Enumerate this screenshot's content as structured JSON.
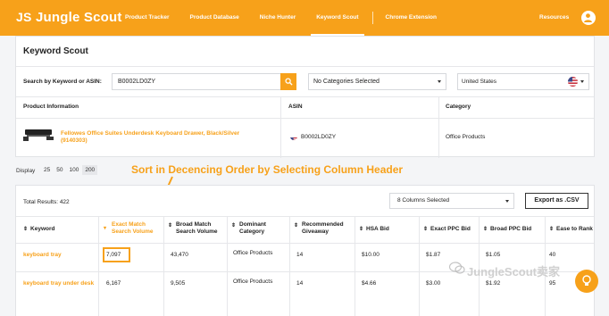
{
  "brand": {
    "name": "Jungle Scout",
    "accent": "#f7a11a"
  },
  "nav": {
    "items": [
      "Product Tracker",
      "Product Database",
      "Niche Hunter",
      "Keyword Scout",
      "Chrome Extension"
    ],
    "active": "Keyword Scout",
    "resources": "Resources"
  },
  "search_panel": {
    "title": "Keyword Scout",
    "search_label": "Search by Keyword or ASIN:",
    "search_value": "B0002LD0ZY",
    "category_select": "No Categories Selected",
    "country_select": "United States",
    "columns": [
      "Product Information",
      "ASIN",
      "Category"
    ],
    "product": {
      "name": "Fellowes Office Suites Underdesk Keyboard Drawer, Black/Silver (9140303)",
      "asin": "B0002LD0ZY",
      "category": "Office Products"
    }
  },
  "display": {
    "label": "Display",
    "options": [
      "25",
      "50",
      "100",
      "200"
    ],
    "selected": "200"
  },
  "annotation": "Sort in Decencing Order by Selecting Column Header",
  "results": {
    "total": "Total Results: 422",
    "columns_select": "8 Columns Selected",
    "export": "Export as .CSV",
    "headers": [
      "Keyword",
      "Exact Match Search Volume",
      "Broad Match Search Volume",
      "Dominant Category",
      "Recommended Giveaway",
      "HSA Bid",
      "Exact PPC Bid",
      "Broad PPC Bid",
      "Ease to Rank"
    ],
    "rows": [
      {
        "keyword": "keyboard tray",
        "exact": "7,097",
        "broad": "43,470",
        "category": "Office Products",
        "giveaway": "14",
        "hsa": "$10.00",
        "exact_ppc": "$1.87",
        "broad_ppc": "$1.05",
        "ease": "40"
      },
      {
        "keyword": "keyboard tray under desk",
        "exact": "6,167",
        "broad": "9,505",
        "category": "Office Products",
        "giveaway": "14",
        "hsa": "$4.66",
        "exact_ppc": "$3.00",
        "broad_ppc": "$1.92",
        "ease": "95"
      }
    ]
  },
  "watermark": "JungleScout卖家"
}
